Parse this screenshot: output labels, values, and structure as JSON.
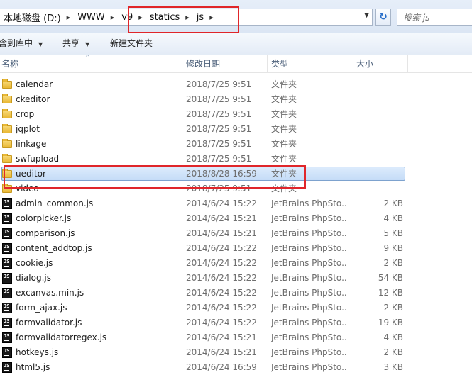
{
  "address": {
    "crumbs": [
      "本地磁盘 (D:)",
      "WWW",
      "v9",
      "statics",
      "js"
    ],
    "dropdown": "▼",
    "refresh": "↻"
  },
  "search": {
    "placeholder": "搜索 js"
  },
  "toolbar": {
    "include_in_library": "含到库中",
    "share": "共享",
    "new_folder": "新建文件夹",
    "arrow": "▼"
  },
  "columns": {
    "name": "名称",
    "date": "修改日期",
    "type": "类型",
    "size": "大小",
    "sort": "^"
  },
  "files": [
    {
      "name": "calendar",
      "date": "2018/7/25 9:51",
      "type": "文件夹",
      "size": "",
      "kind": "folder"
    },
    {
      "name": "ckeditor",
      "date": "2018/7/25 9:51",
      "type": "文件夹",
      "size": "",
      "kind": "folder"
    },
    {
      "name": "crop",
      "date": "2018/7/25 9:51",
      "type": "文件夹",
      "size": "",
      "kind": "folder"
    },
    {
      "name": "jqplot",
      "date": "2018/7/25 9:51",
      "type": "文件夹",
      "size": "",
      "kind": "folder"
    },
    {
      "name": "linkage",
      "date": "2018/7/25 9:51",
      "type": "文件夹",
      "size": "",
      "kind": "folder"
    },
    {
      "name": "swfupload",
      "date": "2018/7/25 9:51",
      "type": "文件夹",
      "size": "",
      "kind": "folder"
    },
    {
      "name": "ueditor",
      "date": "2018/8/28 16:59",
      "type": "文件夹",
      "size": "",
      "kind": "folder",
      "selected": true
    },
    {
      "name": "video",
      "date": "2018/7/25 9:51",
      "type": "文件夹",
      "size": "",
      "kind": "folder"
    },
    {
      "name": "admin_common.js",
      "date": "2014/6/24 15:22",
      "type": "JetBrains PhpSto...",
      "size": "2 KB",
      "kind": "file"
    },
    {
      "name": "colorpicker.js",
      "date": "2014/6/24 15:21",
      "type": "JetBrains PhpSto...",
      "size": "4 KB",
      "kind": "file"
    },
    {
      "name": "comparison.js",
      "date": "2014/6/24 15:21",
      "type": "JetBrains PhpSto...",
      "size": "5 KB",
      "kind": "file"
    },
    {
      "name": "content_addtop.js",
      "date": "2014/6/24 15:22",
      "type": "JetBrains PhpSto...",
      "size": "9 KB",
      "kind": "file"
    },
    {
      "name": "cookie.js",
      "date": "2014/6/24 15:22",
      "type": "JetBrains PhpSto...",
      "size": "2 KB",
      "kind": "file"
    },
    {
      "name": "dialog.js",
      "date": "2014/6/24 15:22",
      "type": "JetBrains PhpSto...",
      "size": "54 KB",
      "kind": "file"
    },
    {
      "name": "excanvas.min.js",
      "date": "2014/6/24 15:22",
      "type": "JetBrains PhpSto...",
      "size": "12 KB",
      "kind": "file"
    },
    {
      "name": "form_ajax.js",
      "date": "2014/6/24 15:22",
      "type": "JetBrains PhpSto...",
      "size": "2 KB",
      "kind": "file"
    },
    {
      "name": "formvalidator.js",
      "date": "2014/6/24 15:22",
      "type": "JetBrains PhpSto...",
      "size": "19 KB",
      "kind": "file"
    },
    {
      "name": "formvalidatorregex.js",
      "date": "2014/6/24 15:21",
      "type": "JetBrains PhpSto...",
      "size": "4 KB",
      "kind": "file"
    },
    {
      "name": "hotkeys.js",
      "date": "2014/6/24 15:21",
      "type": "JetBrains PhpSto...",
      "size": "2 KB",
      "kind": "file"
    },
    {
      "name": "html5.js",
      "date": "2014/6/24 16:59",
      "type": "JetBrains PhpSto...",
      "size": "3 KB",
      "kind": "file"
    }
  ]
}
